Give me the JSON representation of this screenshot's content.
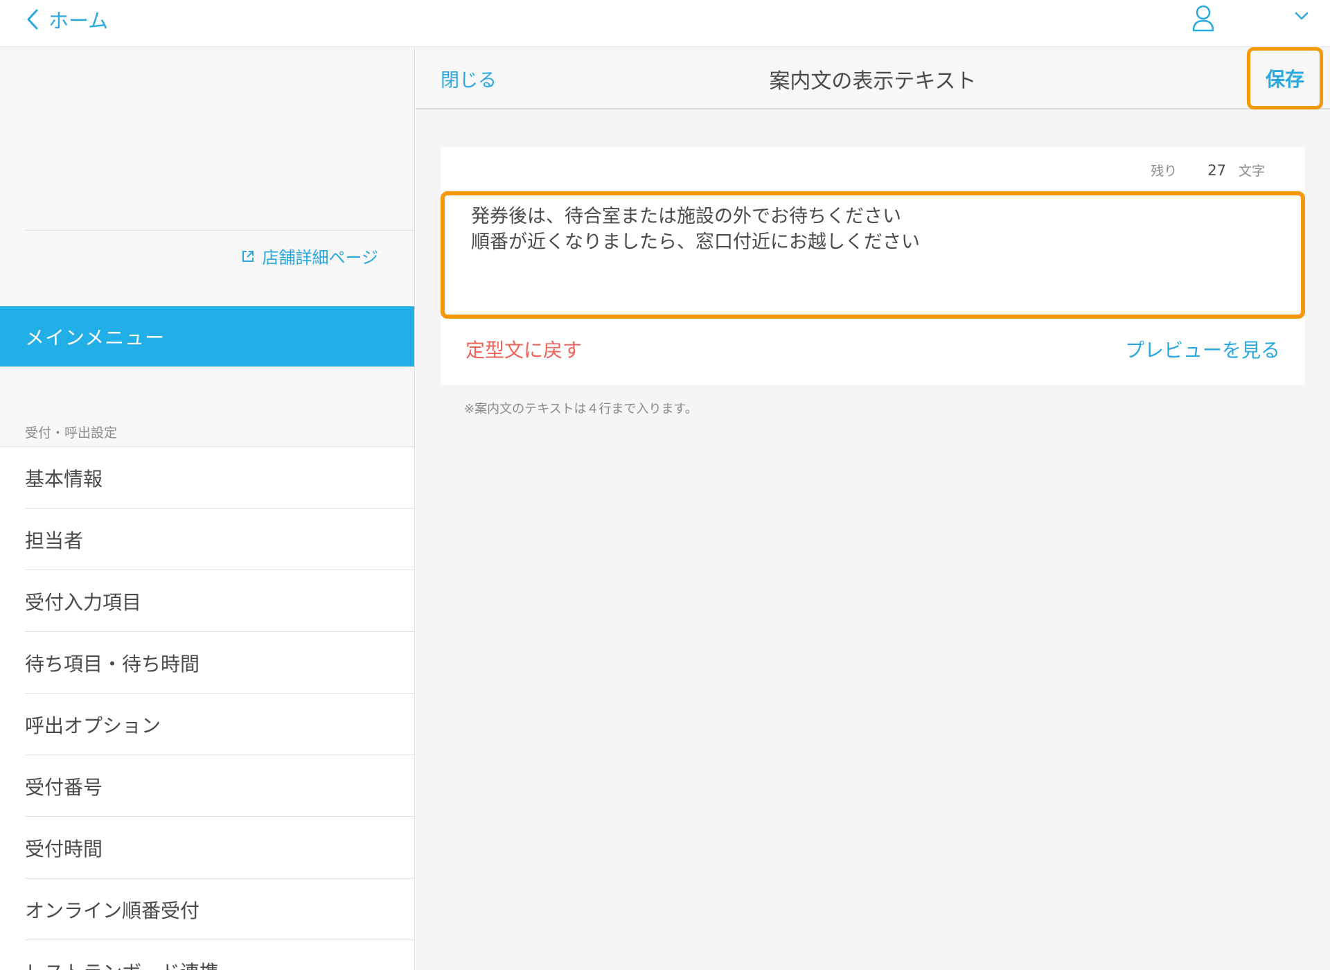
{
  "topbar": {
    "back_label": "ホーム",
    "icons": {
      "back": "chevron-left-icon",
      "user": "user-icon",
      "menu": "chevron-down-icon"
    }
  },
  "sidebar": {
    "store_link_label": "店舗詳細ページ",
    "store_link_icon": "external-link-icon",
    "main_menu_label": "メインメニュー",
    "section_label": "受付・呼出設定",
    "items": [
      {
        "label": "基本情報"
      },
      {
        "label": "担当者"
      },
      {
        "label": "受付入力項目"
      },
      {
        "label": "待ち項目・待ち時間"
      },
      {
        "label": "呼出オプション"
      },
      {
        "label": "受付番号"
      },
      {
        "label": "受付時間"
      },
      {
        "label": "オンライン順番受付"
      },
      {
        "label": "レストランボード連携"
      }
    ]
  },
  "header": {
    "close_label": "閉じる",
    "title": "案内文の表示テキスト",
    "save_label": "保存"
  },
  "editor": {
    "remaining_label": "残り",
    "remaining_count": "27",
    "unit_label": "文字",
    "text": "発券後は、待合室または施設の外でお待ちください\n順番が近くなりましたら、窓口付近にお越しください",
    "reset_label": "定型文に戻す",
    "preview_label": "プレビューを見る",
    "note": "※案内文のテキストは４行まで入ります。"
  },
  "colors": {
    "accent": "#29a8e0",
    "selected_bg": "#22aee6",
    "highlight": "#f49a0a",
    "danger": "#f0635a"
  }
}
